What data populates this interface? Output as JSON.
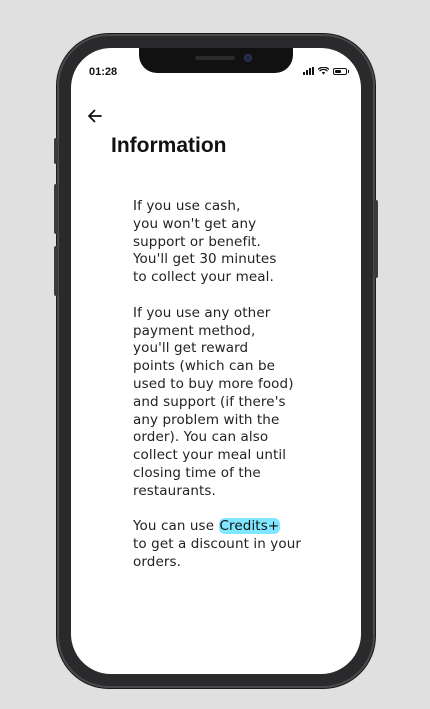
{
  "status_bar": {
    "time": "01:28"
  },
  "header": {
    "back_icon": "arrow-left-icon",
    "title": "Information"
  },
  "info": {
    "cash_lines": [
      "If you use cash,",
      "you won't get any",
      "support or benefit.",
      "You'll get 30 minutes",
      "to collect your meal."
    ],
    "other_lines": [
      "If you use any other",
      "payment method,",
      "you'll get reward",
      "points (which can be",
      "used to buy more food)",
      "and support (if there's",
      "any problem with the",
      "order). You can also",
      "collect your meal until",
      "closing time of the",
      "restaurants."
    ],
    "credits_prefix": "You can use ",
    "credits_link": "Credits+",
    "credits_lines": [
      "to get a discount in your",
      "orders."
    ]
  },
  "colors": {
    "background": "#e0e0e0",
    "frame": "#2a2a2c",
    "screen": "#ffffff",
    "link_highlight": "#7fe7ff"
  }
}
